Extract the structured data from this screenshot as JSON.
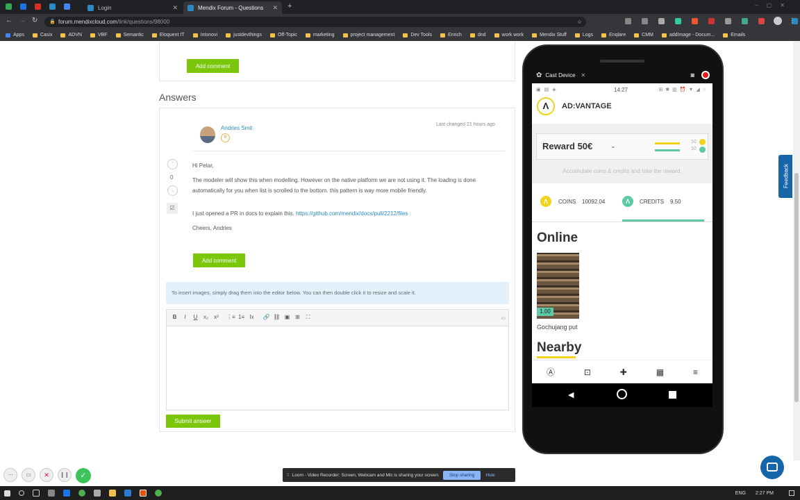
{
  "browser": {
    "tabs": [
      {
        "label": "Login",
        "active": false
      },
      {
        "label": "Mendix Forum - Questions",
        "active": true
      }
    ],
    "new_tab_icon": "plus-icon",
    "url_host": "forum.mendixcloud.com",
    "url_path": "/link/questions/98000",
    "bookmarks": [
      "Apps",
      "Casix",
      "ADVN",
      "VBF",
      "Semantic",
      "Eloquent IT",
      "Intonovi",
      "justdevthings",
      "Off-Topic",
      "marketing",
      "project management",
      "Dev Tools",
      "Enrich",
      "dnd",
      "work work",
      "Mendix Stuff",
      "Logs",
      "Enqlare",
      "CMM",
      "addImage - Docum...",
      "Emails"
    ]
  },
  "forum": {
    "top_add_comment": "Add comment",
    "answers_heading": "Answers",
    "answer": {
      "author": "Andries Smit",
      "badge": "8",
      "last_changed": "Last changed 21 hours ago",
      "vote_count": "0",
      "greeting": "Hi Petar,",
      "paragraph1": "The modeler will show this when modelling. However on the native platform we are not using it. The loading is done automatically for you when list is scrolled to the bottom. this pattern is way more mobile friendly.",
      "paragraph2_prefix": "I just opened a PR in docs to explain this.",
      "paragraph2_link": "https://github.com/mendix/docs/pull/2212/files",
      "signoff": "Cheers, Andries",
      "add_comment": "Add comment"
    },
    "info_text": "To insert images, simply drag them into the editor below. You can then double click it to resize and scale it.",
    "toolbar": [
      "B",
      "I",
      "U",
      "x₂",
      "x²",
      "⋮≡",
      "1≡",
      "Ix",
      "🔗",
      "⛓",
      "▣",
      "⊞",
      "⛶"
    ],
    "submit_label": "Submit answer",
    "feedback_label": "Feedback"
  },
  "cast": {
    "title": "Cast Device",
    "status_time": "14:27",
    "app_name": "AD:VANTAGE",
    "reward_label": "Reward 50€",
    "reward_bar1": "10",
    "reward_bar2": "10",
    "reward_sub": "Accumulate coins & credits and take the reward.",
    "coins_label": "COINS",
    "coins_value": "10092.04",
    "credits_label": "CREDITS",
    "credits_value": "9.50",
    "online_heading": "Online",
    "product_price": "1.00",
    "product_name": "Gochujang put",
    "nearby_heading": "Nearby"
  },
  "loom": {
    "message": "Loom - Video Recorder: Screen, Webcam and Mic is sharing your screen.",
    "stop_label": "Stop sharing",
    "hide_label": "Hide"
  },
  "taskbar": {
    "lang": "ENG",
    "time": "2:27 PM"
  },
  "colors": {
    "accent_green": "#7ac70c",
    "link_blue": "#2a8bc4",
    "info_bg": "#e3f1fb",
    "brand_yellow": "#f2d21b",
    "brand_teal": "#5cc9a7"
  }
}
